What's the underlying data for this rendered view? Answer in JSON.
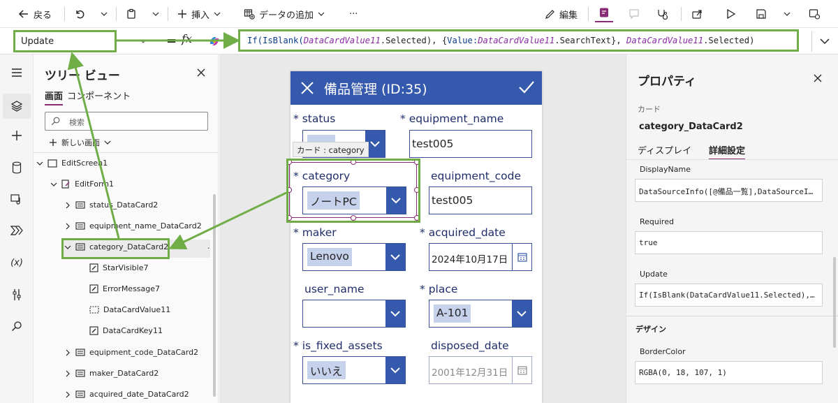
{
  "toolbar": {
    "back": "戻る",
    "insert": "挿入",
    "add_data": "データの追加",
    "more": "···",
    "edit": "編集"
  },
  "formula_bar": {
    "property": "Update",
    "fx": "fx",
    "formula_parts": [
      {
        "t": "If(IsBlank(",
        "c": "fn"
      },
      {
        "t": "DataCardValue11",
        "c": "v"
      },
      {
        "t": ".Selected), {",
        "c": "p"
      },
      {
        "t": "Value:",
        "c": "fn"
      },
      {
        "t": "DataCardValue11",
        "c": "v"
      },
      {
        "t": ".SearchText}, ",
        "c": "p"
      },
      {
        "t": "DataCardValue11",
        "c": "v"
      },
      {
        "t": ".Selected)",
        "c": "p"
      }
    ]
  },
  "tree": {
    "title": "ツリー ビュー",
    "tab_screens": "画面",
    "tab_components": "コンポーネント",
    "search_placeholder": "検索",
    "new_screen": "新しい画面",
    "nodes": [
      "EditScreen1",
      "EditForm1",
      "status_DataCard2",
      "equipment_name_DataCard2",
      "category_DataCard2",
      "StarVisible7",
      "ErrorMessage7",
      "DataCardValue11",
      "DataCardKey11",
      "equipment_code_DataCard2",
      "maker_DataCard2",
      "acquired_date_DataCard2"
    ]
  },
  "form": {
    "title": "備品管理 (ID:35)",
    "tooltip": "カード : category",
    "fields": {
      "status": "status",
      "equipment_name": "equipment_name",
      "equipment_name_value": "test005",
      "category": "category",
      "category_value": "ノートPC",
      "equipment_code": "equipment_code",
      "equipment_code_value": "test005",
      "maker": "maker",
      "maker_value": "Lenovo",
      "acquired_date": "acquired_date",
      "acquired_date_value": "2024年10月17日",
      "user_name": "user_name",
      "place": "place",
      "place_value": "A-101",
      "is_fixed_assets": "is_fixed_assets",
      "is_fixed_assets_value": "いいえ",
      "disposed_date": "disposed_date",
      "disposed_date_value": "2001年12月31日"
    },
    "required_mark": "*"
  },
  "properties": {
    "title": "プロパティ",
    "kind": "カード",
    "name": "category_DataCard2",
    "tab_display": "ディスプレイ",
    "tab_advanced": "詳細設定",
    "display_name_label": "DisplayName",
    "display_name_value": "DataSourceInfo([@備品一覧],DataSourceI…",
    "required_label": "Required",
    "required_value": "true",
    "update_label": "Update",
    "update_value": "If(IsBlank(DataCardValue11.Selected),…",
    "design_header": "デザイン",
    "border_color_label": "BorderColor",
    "border_color_value": "RGBA(0, 18, 107, 1)"
  },
  "colors": {
    "form_header": "#3559ac",
    "annotation": "#70ad47",
    "selection": "#8a2b76"
  }
}
